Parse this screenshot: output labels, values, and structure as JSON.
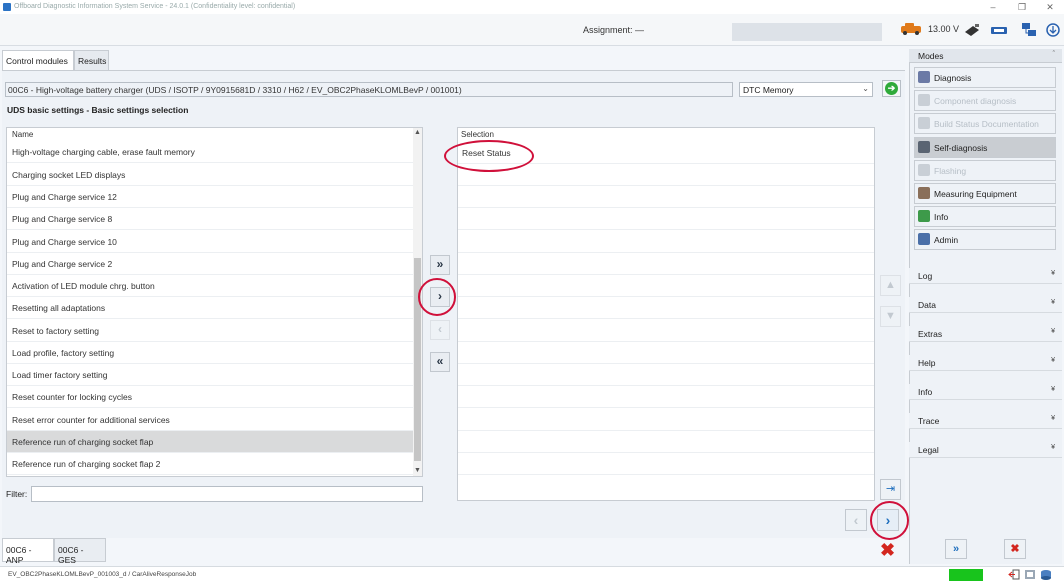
{
  "window": {
    "title": "Offboard Diagnostic Information System Service - 24.0.1 (Confidentiality level: confidential)",
    "minimize": "–",
    "restore": "❐",
    "close": "✕"
  },
  "header": {
    "assignment_label": "Assignment:",
    "assignment_value": "—",
    "voltage": "13.00 V"
  },
  "tabs": [
    {
      "label": "Control modules"
    },
    {
      "label": "Results"
    }
  ],
  "ecu": {
    "field": "00C6 - High-voltage battery charger  (UDS / ISOTP / 9Y0915681D / 3310 / H62 / EV_OBC2PhaseKLOMLBevP / 001001)",
    "dropdown": "DTC Memory",
    "dropdown_chevron": "⌄",
    "go_symbol": "➔"
  },
  "section_title": "UDS basic settings - Basic settings selection",
  "left_list": {
    "header": "Name",
    "items": [
      "High-voltage charging cable, erase fault memory",
      "Charging socket LED displays",
      "Plug and Charge service 12",
      "Plug and Charge service 8",
      "Plug and Charge service 10",
      "Plug and Charge service 2",
      "Activation of LED module chrg. button",
      "Resetting all adaptations",
      "Reset to factory setting",
      "Load profile, factory setting",
      "Load timer factory setting",
      "Reset counter for locking cycles",
      "Reset error counter for additional services",
      "Reference run of charging socket flap",
      "Reference run of charging socket flap 2"
    ],
    "selected_index": 13,
    "scroll_up": "▲",
    "scroll_down": "▼"
  },
  "transfer_buttons": {
    "add_all": "»",
    "add_one": "›",
    "remove_one": "‹",
    "remove_all": "«"
  },
  "right_list": {
    "header": "Selection",
    "items": [
      "Reset Status"
    ]
  },
  "side_buttons": {
    "up": "▲",
    "down": "▼",
    "last": "⇥"
  },
  "filter": {
    "label": "Filter:",
    "value": ""
  },
  "nav": {
    "prev": "‹",
    "next": "›"
  },
  "bottom_tabs": [
    {
      "label": "00C6 - ANP"
    },
    {
      "label": "00C6 - GES"
    }
  ],
  "cancel_symbol": "✖",
  "sidebar": {
    "title": "Modes",
    "collapse_caret": "ˆ",
    "items": [
      {
        "label": "Diagnosis",
        "state": "normal",
        "icon_color": "#6b7aa6"
      },
      {
        "label": "Component diagnosis",
        "state": "disabled",
        "icon_color": "#c9cfd6"
      },
      {
        "label": "Build Status Documentation",
        "state": "disabled",
        "icon_color": "#c9cfd6"
      },
      {
        "label": "Self-diagnosis",
        "state": "active",
        "icon_color": "#5a6472"
      },
      {
        "label": "Flashing",
        "state": "disabled",
        "icon_color": "#c9cfd6"
      },
      {
        "label": "Measuring Equipment",
        "state": "normal",
        "icon_color": "#8a6f5a"
      },
      {
        "label": "Info",
        "state": "normal",
        "icon_color": "#3d9a4a"
      },
      {
        "label": "Admin",
        "state": "normal",
        "icon_color": "#4a6fa8"
      }
    ],
    "sections": [
      {
        "label": "Log"
      },
      {
        "label": "Data"
      },
      {
        "label": "Extras"
      },
      {
        "label": "Help"
      },
      {
        "label": "Info"
      },
      {
        "label": "Trace"
      },
      {
        "label": "Legal"
      }
    ],
    "section_caret": "¥",
    "forward": "»",
    "close": "✖"
  },
  "statusbar": {
    "path": "EV_OBC2PhaseKLOMLBevP_001003_d / CarAliveResponseJob"
  },
  "colors": {
    "accent": "#1f6fbe",
    "highlight_circle": "#d0103a",
    "status_ok": "#18c41c",
    "cancel": "#d3261e"
  }
}
